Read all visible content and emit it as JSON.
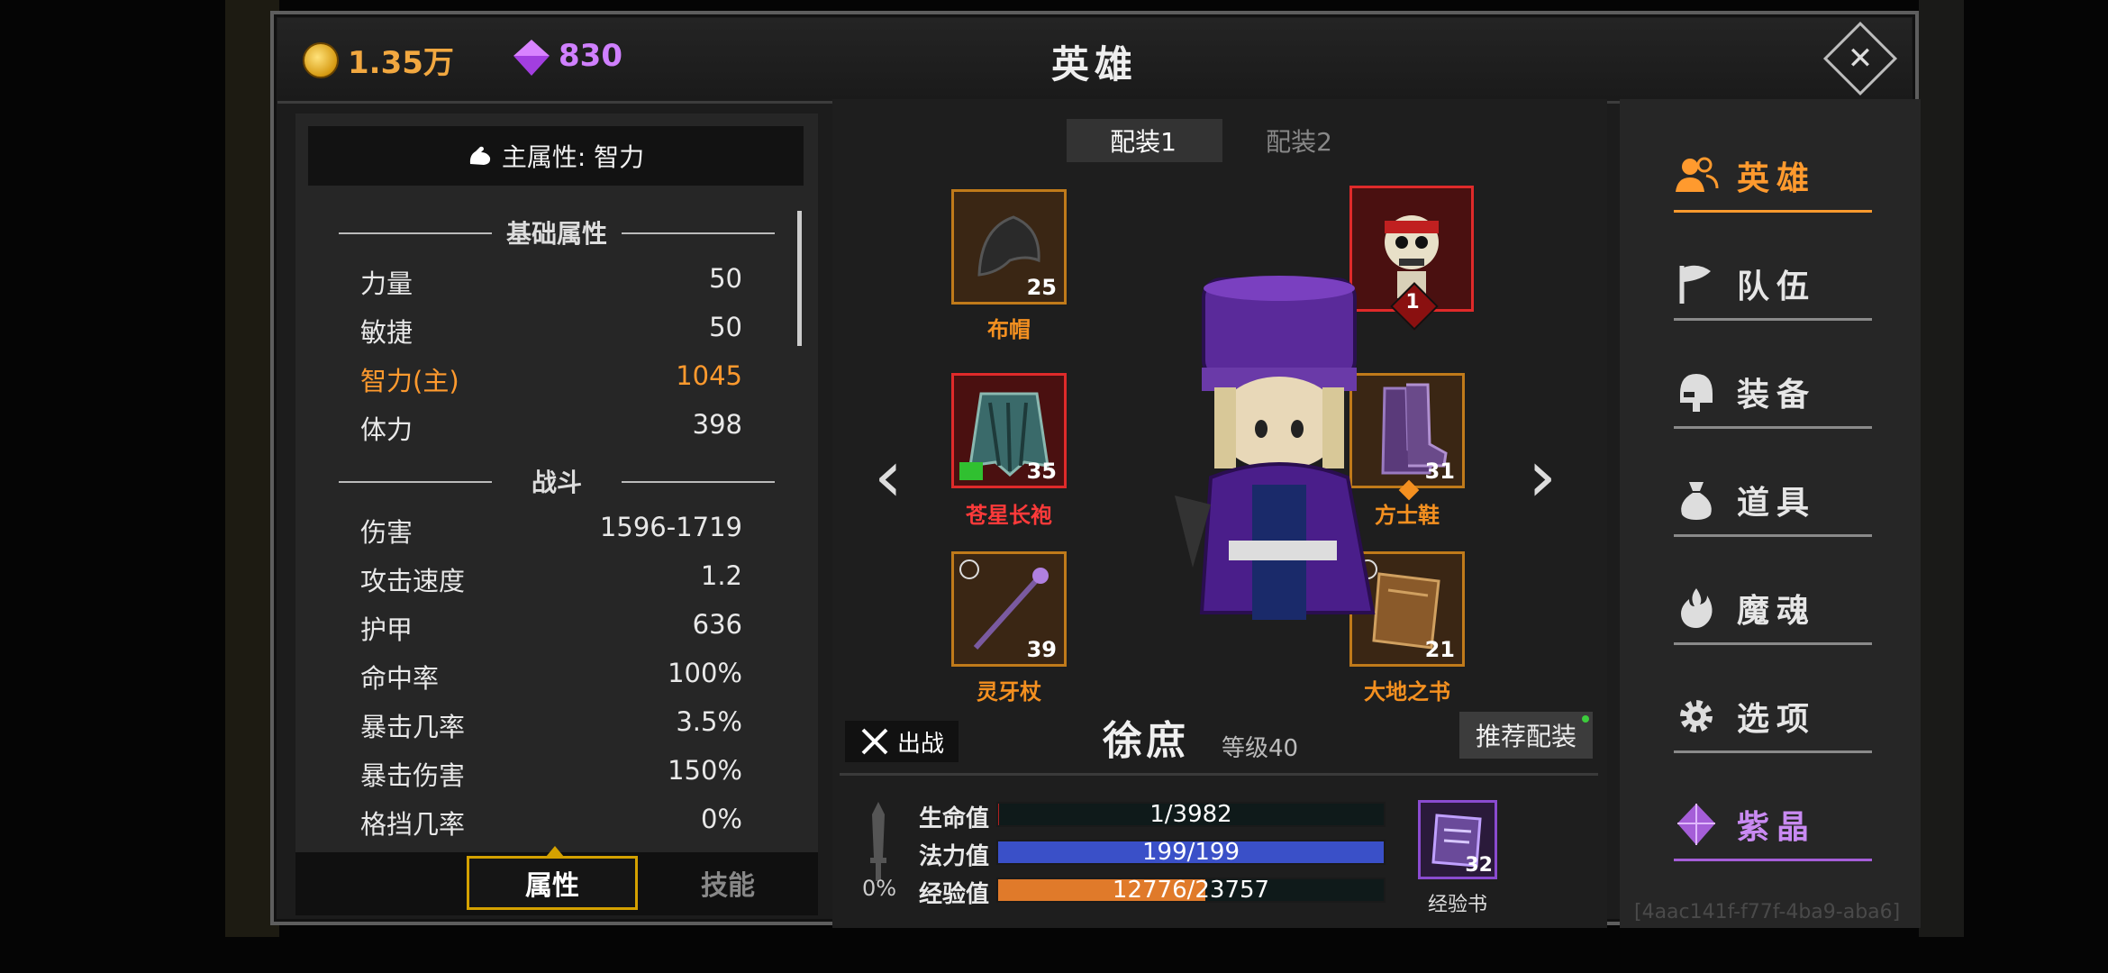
{
  "header": {
    "gold": "1.35万",
    "gems": "830",
    "title": "英雄",
    "close_icon": "close-icon"
  },
  "stats": {
    "main_attribute": "主属性: 智力",
    "base_title": "基础属性",
    "base": [
      {
        "label": "力量",
        "value": "50"
      },
      {
        "label": "敏捷",
        "value": "50"
      },
      {
        "label": "智力(主)",
        "value": "1045"
      },
      {
        "label": "体力",
        "value": "398"
      }
    ],
    "combat_title": "战斗",
    "combat": [
      {
        "label": "伤害",
        "value": "1596-1719"
      },
      {
        "label": "攻击速度",
        "value": "1.2"
      },
      {
        "label": "护甲",
        "value": "636"
      },
      {
        "label": "命中率",
        "value": "100%"
      },
      {
        "label": "暴击几率",
        "value": "3.5%"
      },
      {
        "label": "暴击伤害",
        "value": "150%"
      },
      {
        "label": "格挡几率",
        "value": "0%"
      }
    ],
    "tabs": {
      "attributes": "属性",
      "skills": "技能"
    }
  },
  "loadout": {
    "tabs": [
      "配装1",
      "配装2"
    ],
    "slots": {
      "hat": {
        "name": "布帽",
        "level": "25"
      },
      "companion": {
        "level": "1"
      },
      "robe": {
        "name": "苍星长袍",
        "level": "35"
      },
      "shoes": {
        "name": "方士鞋",
        "level": "31"
      },
      "staff": {
        "name": "灵牙杖",
        "level": "39"
      },
      "book": {
        "name": "大地之书",
        "level": "21"
      }
    },
    "prev_arrow": "‹",
    "next_arrow": "›"
  },
  "hero": {
    "fight_label": "出战",
    "name": "徐庶",
    "level": "等级40",
    "recommend": "推荐配装",
    "crit_pct": "0%",
    "hp": {
      "label": "生命值",
      "text": "1/3982",
      "fraction": 0.00025
    },
    "mp": {
      "label": "法力值",
      "text": "199/199",
      "fraction": 1.0
    },
    "exp": {
      "label": "经验值",
      "text": "12776/23757",
      "fraction": 0.538
    },
    "exp_book": {
      "label": "经验书",
      "count": "32"
    }
  },
  "menu": [
    {
      "label": "英雄",
      "icon": "users-icon"
    },
    {
      "label": "队伍",
      "icon": "flag-icon"
    },
    {
      "label": "装备",
      "icon": "helmet-icon"
    },
    {
      "label": "道具",
      "icon": "bag-icon"
    },
    {
      "label": "魔魂",
      "icon": "flame-icon"
    },
    {
      "label": "选项",
      "icon": "gear-icon"
    },
    {
      "label": "紫晶",
      "icon": "crystal-icon"
    }
  ],
  "footer_id": "[4aac141f-f77f-4ba9-aba6]",
  "colors": {
    "accent": "#ff9a2e",
    "purple": "#c98af2",
    "mp_bar": "#3a50c8",
    "exp_bar": "#e07a2a"
  }
}
